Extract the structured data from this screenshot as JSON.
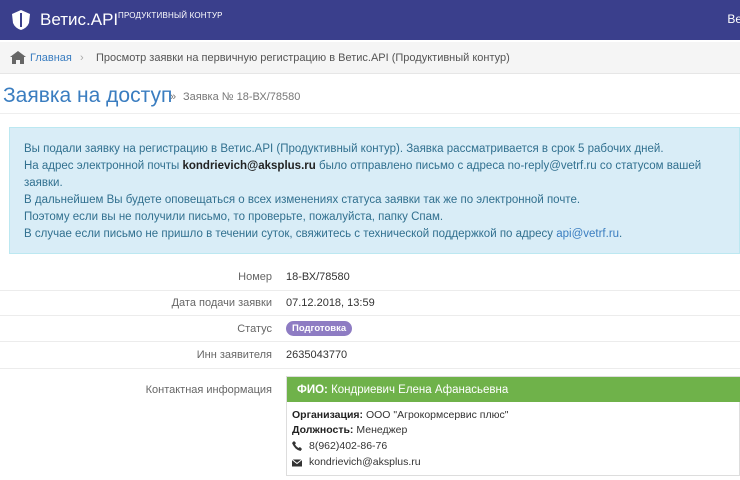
{
  "header": {
    "brand": "Ветис.API",
    "subtitle": "ПРОДУКТИВНЫЙ КОНТУР",
    "right_text": "Ве",
    "bg_color": "#3a3f8c"
  },
  "breadcrumb": {
    "home": "Главная",
    "separator": "›",
    "current": "Просмотр заявки на первичную регистрацию в Ветис.API (Продуктивный контур)"
  },
  "page": {
    "title": "Заявка на доступ",
    "title_separator": "»",
    "subtitle": "Заявка № 18-ВХ/78580"
  },
  "alert": {
    "line1": "Вы подали заявку на регистрацию в Ветис.API (Продуктивный контур). Заявка рассматривается в срок 5 рабочих дней.",
    "line2_pre": "На адрес электронной почты ",
    "line2_email": "kondrievich@aksplus.ru",
    "line2_post": " было отправлено письмо с адреса no-reply@vetrf.ru со статусом вашей",
    "line3": "заявки.",
    "line4": "В дальнейшем Вы будете оповещаться о всех изменениях статуса заявки так же по электронной почте.",
    "line5": "Поэтому если вы не получили письмо, то проверьте, пожалуйста, папку Спам.",
    "line6_pre": "В случае если письмо не пришло в течении суток, свяжитесь с технической поддержкой по адресу ",
    "line6_link": "api@vetrf.ru",
    "line6_post": "."
  },
  "details": {
    "number_label": "Номер",
    "number_value": "18-ВХ/78580",
    "date_label": "Дата подачи заявки",
    "date_value": "07.12.2018, 13:59",
    "status_label": "Статус",
    "status_value": "Подготовка",
    "inn_label": "Инн заявителя",
    "inn_value": "2635043770",
    "contact_label": "Контактная информация"
  },
  "contact": {
    "fio_label": "ФИО:",
    "fio_value": "Кондриевич Елена Афанасьевна",
    "org_label": "Организация:",
    "org_value": "ООО \"Агрокормсервис плюс\"",
    "position_label": "Должность:",
    "position_value": "Менеджер",
    "phone": "8(962)402-86-76",
    "email": "kondrievich@aksplus.ru",
    "icons": [
      "phone-icon",
      "envelope-icon"
    ]
  }
}
